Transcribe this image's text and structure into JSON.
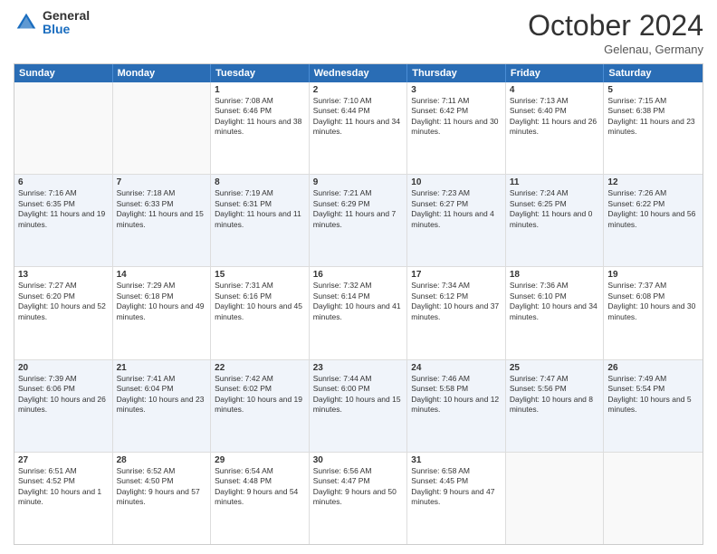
{
  "logo": {
    "general": "General",
    "blue": "Blue"
  },
  "title": "October 2024",
  "location": "Gelenau, Germany",
  "days_of_week": [
    "Sunday",
    "Monday",
    "Tuesday",
    "Wednesday",
    "Thursday",
    "Friday",
    "Saturday"
  ],
  "weeks": [
    [
      {
        "day": "",
        "info": ""
      },
      {
        "day": "",
        "info": ""
      },
      {
        "day": "1",
        "info": "Sunrise: 7:08 AM\nSunset: 6:46 PM\nDaylight: 11 hours and 38 minutes."
      },
      {
        "day": "2",
        "info": "Sunrise: 7:10 AM\nSunset: 6:44 PM\nDaylight: 11 hours and 34 minutes."
      },
      {
        "day": "3",
        "info": "Sunrise: 7:11 AM\nSunset: 6:42 PM\nDaylight: 11 hours and 30 minutes."
      },
      {
        "day": "4",
        "info": "Sunrise: 7:13 AM\nSunset: 6:40 PM\nDaylight: 11 hours and 26 minutes."
      },
      {
        "day": "5",
        "info": "Sunrise: 7:15 AM\nSunset: 6:38 PM\nDaylight: 11 hours and 23 minutes."
      }
    ],
    [
      {
        "day": "6",
        "info": "Sunrise: 7:16 AM\nSunset: 6:35 PM\nDaylight: 11 hours and 19 minutes."
      },
      {
        "day": "7",
        "info": "Sunrise: 7:18 AM\nSunset: 6:33 PM\nDaylight: 11 hours and 15 minutes."
      },
      {
        "day": "8",
        "info": "Sunrise: 7:19 AM\nSunset: 6:31 PM\nDaylight: 11 hours and 11 minutes."
      },
      {
        "day": "9",
        "info": "Sunrise: 7:21 AM\nSunset: 6:29 PM\nDaylight: 11 hours and 7 minutes."
      },
      {
        "day": "10",
        "info": "Sunrise: 7:23 AM\nSunset: 6:27 PM\nDaylight: 11 hours and 4 minutes."
      },
      {
        "day": "11",
        "info": "Sunrise: 7:24 AM\nSunset: 6:25 PM\nDaylight: 11 hours and 0 minutes."
      },
      {
        "day": "12",
        "info": "Sunrise: 7:26 AM\nSunset: 6:22 PM\nDaylight: 10 hours and 56 minutes."
      }
    ],
    [
      {
        "day": "13",
        "info": "Sunrise: 7:27 AM\nSunset: 6:20 PM\nDaylight: 10 hours and 52 minutes."
      },
      {
        "day": "14",
        "info": "Sunrise: 7:29 AM\nSunset: 6:18 PM\nDaylight: 10 hours and 49 minutes."
      },
      {
        "day": "15",
        "info": "Sunrise: 7:31 AM\nSunset: 6:16 PM\nDaylight: 10 hours and 45 minutes."
      },
      {
        "day": "16",
        "info": "Sunrise: 7:32 AM\nSunset: 6:14 PM\nDaylight: 10 hours and 41 minutes."
      },
      {
        "day": "17",
        "info": "Sunrise: 7:34 AM\nSunset: 6:12 PM\nDaylight: 10 hours and 37 minutes."
      },
      {
        "day": "18",
        "info": "Sunrise: 7:36 AM\nSunset: 6:10 PM\nDaylight: 10 hours and 34 minutes."
      },
      {
        "day": "19",
        "info": "Sunrise: 7:37 AM\nSunset: 6:08 PM\nDaylight: 10 hours and 30 minutes."
      }
    ],
    [
      {
        "day": "20",
        "info": "Sunrise: 7:39 AM\nSunset: 6:06 PM\nDaylight: 10 hours and 26 minutes."
      },
      {
        "day": "21",
        "info": "Sunrise: 7:41 AM\nSunset: 6:04 PM\nDaylight: 10 hours and 23 minutes."
      },
      {
        "day": "22",
        "info": "Sunrise: 7:42 AM\nSunset: 6:02 PM\nDaylight: 10 hours and 19 minutes."
      },
      {
        "day": "23",
        "info": "Sunrise: 7:44 AM\nSunset: 6:00 PM\nDaylight: 10 hours and 15 minutes."
      },
      {
        "day": "24",
        "info": "Sunrise: 7:46 AM\nSunset: 5:58 PM\nDaylight: 10 hours and 12 minutes."
      },
      {
        "day": "25",
        "info": "Sunrise: 7:47 AM\nSunset: 5:56 PM\nDaylight: 10 hours and 8 minutes."
      },
      {
        "day": "26",
        "info": "Sunrise: 7:49 AM\nSunset: 5:54 PM\nDaylight: 10 hours and 5 minutes."
      }
    ],
    [
      {
        "day": "27",
        "info": "Sunrise: 6:51 AM\nSunset: 4:52 PM\nDaylight: 10 hours and 1 minute."
      },
      {
        "day": "28",
        "info": "Sunrise: 6:52 AM\nSunset: 4:50 PM\nDaylight: 9 hours and 57 minutes."
      },
      {
        "day": "29",
        "info": "Sunrise: 6:54 AM\nSunset: 4:48 PM\nDaylight: 9 hours and 54 minutes."
      },
      {
        "day": "30",
        "info": "Sunrise: 6:56 AM\nSunset: 4:47 PM\nDaylight: 9 hours and 50 minutes."
      },
      {
        "day": "31",
        "info": "Sunrise: 6:58 AM\nSunset: 4:45 PM\nDaylight: 9 hours and 47 minutes."
      },
      {
        "day": "",
        "info": ""
      },
      {
        "day": "",
        "info": ""
      }
    ]
  ]
}
